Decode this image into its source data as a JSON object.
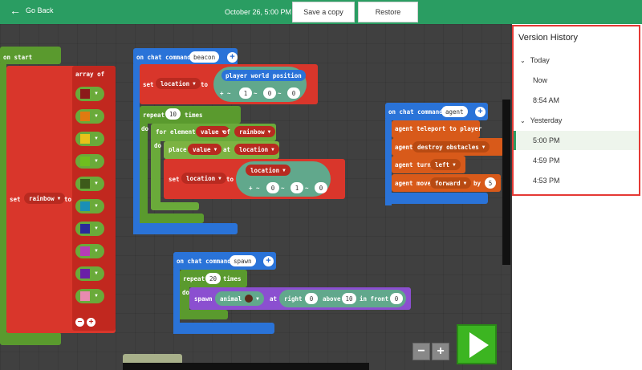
{
  "header": {
    "back_label": "Go Back",
    "date_label": "October 26, 5:00 PM",
    "save_copy_label": "Save a copy",
    "restore_label": "Restore"
  },
  "colors": {
    "header": "#2a9d62",
    "workspace": "#404040",
    "events": "#2a73d8",
    "loops": "#5a9a2e",
    "variables": "#d9362b",
    "agent": "#d85a1a",
    "mobs": "#8b4fd0",
    "positions": "#61a88c",
    "highlight": "#e53935"
  },
  "blocks": {
    "on_start": {
      "label": "on start"
    },
    "set_rainbow": {
      "set": "set",
      "var": "rainbow",
      "to": "to"
    },
    "array": {
      "label": "array of",
      "items": [
        "red wool",
        "orange wool",
        "yellow wool",
        "lime wool",
        "green wool",
        "cyan wool",
        "blue wool",
        "magenta wool",
        "purple wool",
        "pink wool"
      ]
    },
    "beacon": {
      "event": "on chat command",
      "command": "beacon",
      "set": "set",
      "var": "location",
      "to": "to",
      "pos_label": "player world position",
      "coords": [
        "1",
        "0",
        "0"
      ],
      "repeat": "repeat",
      "times_value": "10",
      "times": "times",
      "do": "do",
      "for_element": "for element",
      "value": "value",
      "of": "of",
      "array_var": "rainbow",
      "do2": "do",
      "place": "place",
      "place_value": "value",
      "at": "at",
      "at_var": "location",
      "set2": "set",
      "var2": "location",
      "to2": "to",
      "loc_label": "location",
      "coords2": [
        "0",
        "1",
        "0"
      ]
    },
    "agent": {
      "event": "on chat command",
      "command": "agent",
      "teleport": "agent teleport to player",
      "destroy": "agent",
      "destroy_opt": "destroy obstacles",
      "turn": "agent turn",
      "turn_opt": "left",
      "move": "agent move",
      "move_opt": "forward",
      "by": "by",
      "move_value": "5"
    },
    "spawn": {
      "event": "on chat command",
      "command": "spawn",
      "repeat": "repeat",
      "times_value": "20",
      "times": "times",
      "do": "do",
      "spawn": "spawn",
      "animal": "animal",
      "right": "right",
      "right_value": "0",
      "above": "above",
      "above_value": "10",
      "front": "in front",
      "front_value": "0"
    }
  },
  "version_history": {
    "title": "Version History",
    "groups": [
      {
        "label": "Today",
        "items": [
          "Now",
          "8:54 AM"
        ]
      },
      {
        "label": "Yesterday",
        "items": [
          "5:00 PM",
          "4:59 PM",
          "4:53 PM"
        ]
      }
    ],
    "selected": "5:00 PM"
  }
}
